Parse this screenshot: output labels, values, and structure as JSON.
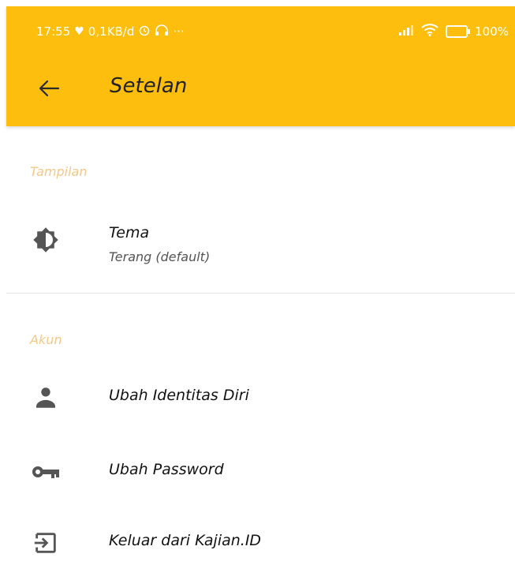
{
  "status_bar": {
    "time": "17:55",
    "data_rate": "0,1KB/d",
    "dots": "···",
    "battery": "100%"
  },
  "app_bar": {
    "title": "Setelan",
    "color": "#FDBE0D"
  },
  "sections": [
    {
      "header": "Tampilan",
      "items": [
        {
          "label": "Tema",
          "sublabel": "Terang (default)",
          "icon": "brightness-icon"
        }
      ]
    },
    {
      "header": "Akun",
      "items": [
        {
          "label": "Ubah Identitas Diri",
          "icon": "person-icon"
        },
        {
          "label": "Ubah Password",
          "icon": "key-icon"
        },
        {
          "label": "Keluar dari Kajian.ID",
          "icon": "logout-icon"
        }
      ]
    }
  ]
}
